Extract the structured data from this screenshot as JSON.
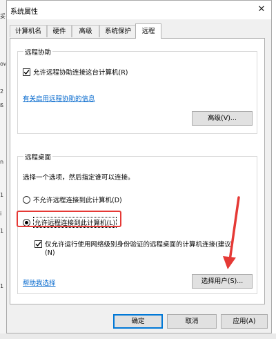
{
  "window": {
    "title": "系统属性",
    "close_glyph": "✕"
  },
  "background": {
    "fragments": [
      "妥",
      "ow",
      "2",
      "ß",
      "n",
      "1",
      "i",
      "1",
      "1"
    ]
  },
  "tabs": [
    {
      "label": "计算机名",
      "active": false
    },
    {
      "label": "硬件",
      "active": false
    },
    {
      "label": "高级",
      "active": false
    },
    {
      "label": "系统保护",
      "active": false
    },
    {
      "label": "远程",
      "active": true
    }
  ],
  "remote_assistance": {
    "group_title": "远程协助",
    "allow_checkbox_label": "允许远程协助连接这台计算机(R)",
    "allow_checked": true,
    "info_link": "有关启用远程协助的信息",
    "advanced_button": "高级(V)..."
  },
  "remote_desktop": {
    "group_title": "远程桌面",
    "instruction": "选择一个选项，然后指定谁可以连接。",
    "option_deny": "不允许远程连接到此计算机(D)",
    "option_allow": "允许远程连接到此计算机(L)",
    "selected": "allow",
    "nla_line1": "仅允许运行使用网络级别身份验证的远程桌面的计算机连接(建议)",
    "nla_line2": "(N)",
    "nla_checked": true,
    "help_link": "帮助我选择",
    "select_users_button": "选择用户(S)..."
  },
  "footer": {
    "ok_button": "确定",
    "cancel_button": "取消",
    "apply_button": "应用(A)"
  },
  "colors": {
    "highlight": "#e53935",
    "link": "#0066cc",
    "default_button_border": "#0078d7"
  }
}
